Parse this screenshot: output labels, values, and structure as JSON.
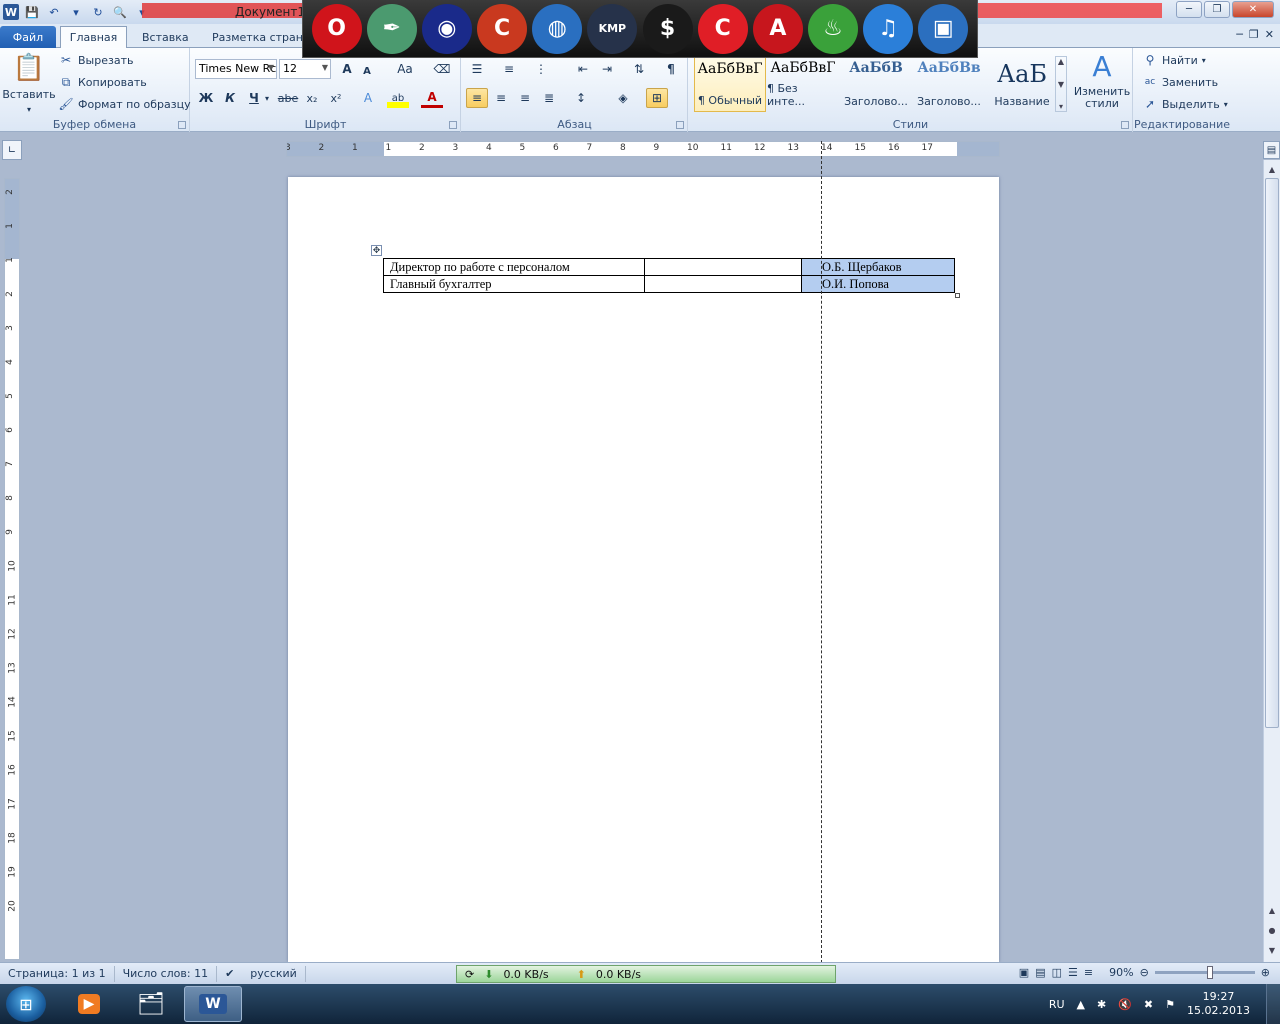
{
  "window": {
    "title": "Документ1",
    "controls": {
      "minimize": "─",
      "maximize": "❐",
      "close": "✕"
    }
  },
  "qat": {
    "logo": "W"
  },
  "dock_icons": [
    {
      "name": "opera-icon",
      "color": "#d0141b",
      "glyph": "O"
    },
    {
      "name": "feather-app-icon",
      "color": "#4b9a6f",
      "glyph": "✒"
    },
    {
      "name": "media-disc-icon",
      "color": "#1a2a8a",
      "glyph": "◉"
    },
    {
      "name": "ccleaner-icon",
      "color": "#c9391f",
      "glyph": "C"
    },
    {
      "name": "globe-icon",
      "color": "#2a6fc0",
      "glyph": "◍"
    },
    {
      "name": "kmplayer-icon",
      "color": "#26324a",
      "glyph": "KMP"
    },
    {
      "name": "artmoney-icon",
      "color": "#1a1a1a",
      "glyph": "$"
    },
    {
      "name": "red-c-app-icon",
      "color": "#e01e26",
      "glyph": "C"
    },
    {
      "name": "acrobat-icon",
      "color": "#c7161d",
      "glyph": "A"
    },
    {
      "name": "drinks-app-icon",
      "color": "#3aa13a",
      "glyph": "♨"
    },
    {
      "name": "itunes-icon",
      "color": "#2b7fd9",
      "glyph": "♫"
    },
    {
      "name": "desktop-monitor-icon",
      "color": "#2b6fbf",
      "glyph": "▣"
    }
  ],
  "tabs": {
    "file": "Файл",
    "home": "Главная",
    "insert": "Вставка",
    "layout": "Разметка страни"
  },
  "ribbon": {
    "clipboard": {
      "label": "Буфер обмена",
      "paste": "Вставить",
      "cut": "Вырезать",
      "copy": "Копировать",
      "format_painter": "Формат по образцу"
    },
    "font": {
      "label": "Шрифт",
      "family": "Times New Rc",
      "size": "12",
      "grow": "A",
      "shrink": "A",
      "case": "Aa",
      "bold": "Ж",
      "italic": "К",
      "underline": "Ч",
      "strike": "abe",
      "subscript": "x₂",
      "superscript": "x²",
      "highlight": "ab",
      "color": "A"
    },
    "paragraph": {
      "label": "Абзац",
      "pilcrow": "¶"
    },
    "styles": {
      "label": "Стили",
      "items": [
        {
          "sample": "АаБбВвГ",
          "name": "¶ Обычный"
        },
        {
          "sample": "АаБбВвГ",
          "name": "¶ Без инте..."
        },
        {
          "sample": "АаБбВ",
          "name": "Заголово..."
        },
        {
          "sample": "АаБбВв",
          "name": "Заголово..."
        },
        {
          "sample": "АаБ",
          "name": "Название"
        }
      ],
      "change": "Изменить стили"
    },
    "editing": {
      "label": "Редактирование",
      "find": "Найти",
      "replace": "Заменить",
      "select": "Выделить"
    }
  },
  "ruler": {
    "h_numbers": [
      "3",
      "2",
      "1",
      "1",
      "2",
      "3",
      "4",
      "5",
      "6",
      "7",
      "8",
      "9",
      "10",
      "11",
      "12",
      "13",
      "14",
      "15",
      "16",
      "17"
    ],
    "v_numbers": [
      "2",
      "1",
      "1",
      "2",
      "3",
      "4",
      "5",
      "6",
      "7",
      "8",
      "9",
      "10",
      "11",
      "12",
      "13",
      "14",
      "15",
      "16",
      "17",
      "18",
      "19",
      "20"
    ]
  },
  "table": {
    "rows": [
      {
        "position": "Директор по работе с персоналом",
        "signature": "",
        "name": "О.Б. Щербаков"
      },
      {
        "position": "Главный бухгалтер",
        "signature": "",
        "name": "О.И. Попова"
      }
    ]
  },
  "status": {
    "page": "Страница: 1 из 1",
    "words": "Число слов: 11",
    "language": "русский",
    "net_down": "0.0 KB/s",
    "net_up": "0.0 KB/s",
    "zoom": "90%"
  },
  "taskbar": {
    "lang": "RU",
    "time": "19:27",
    "date": "15.02.2013"
  }
}
